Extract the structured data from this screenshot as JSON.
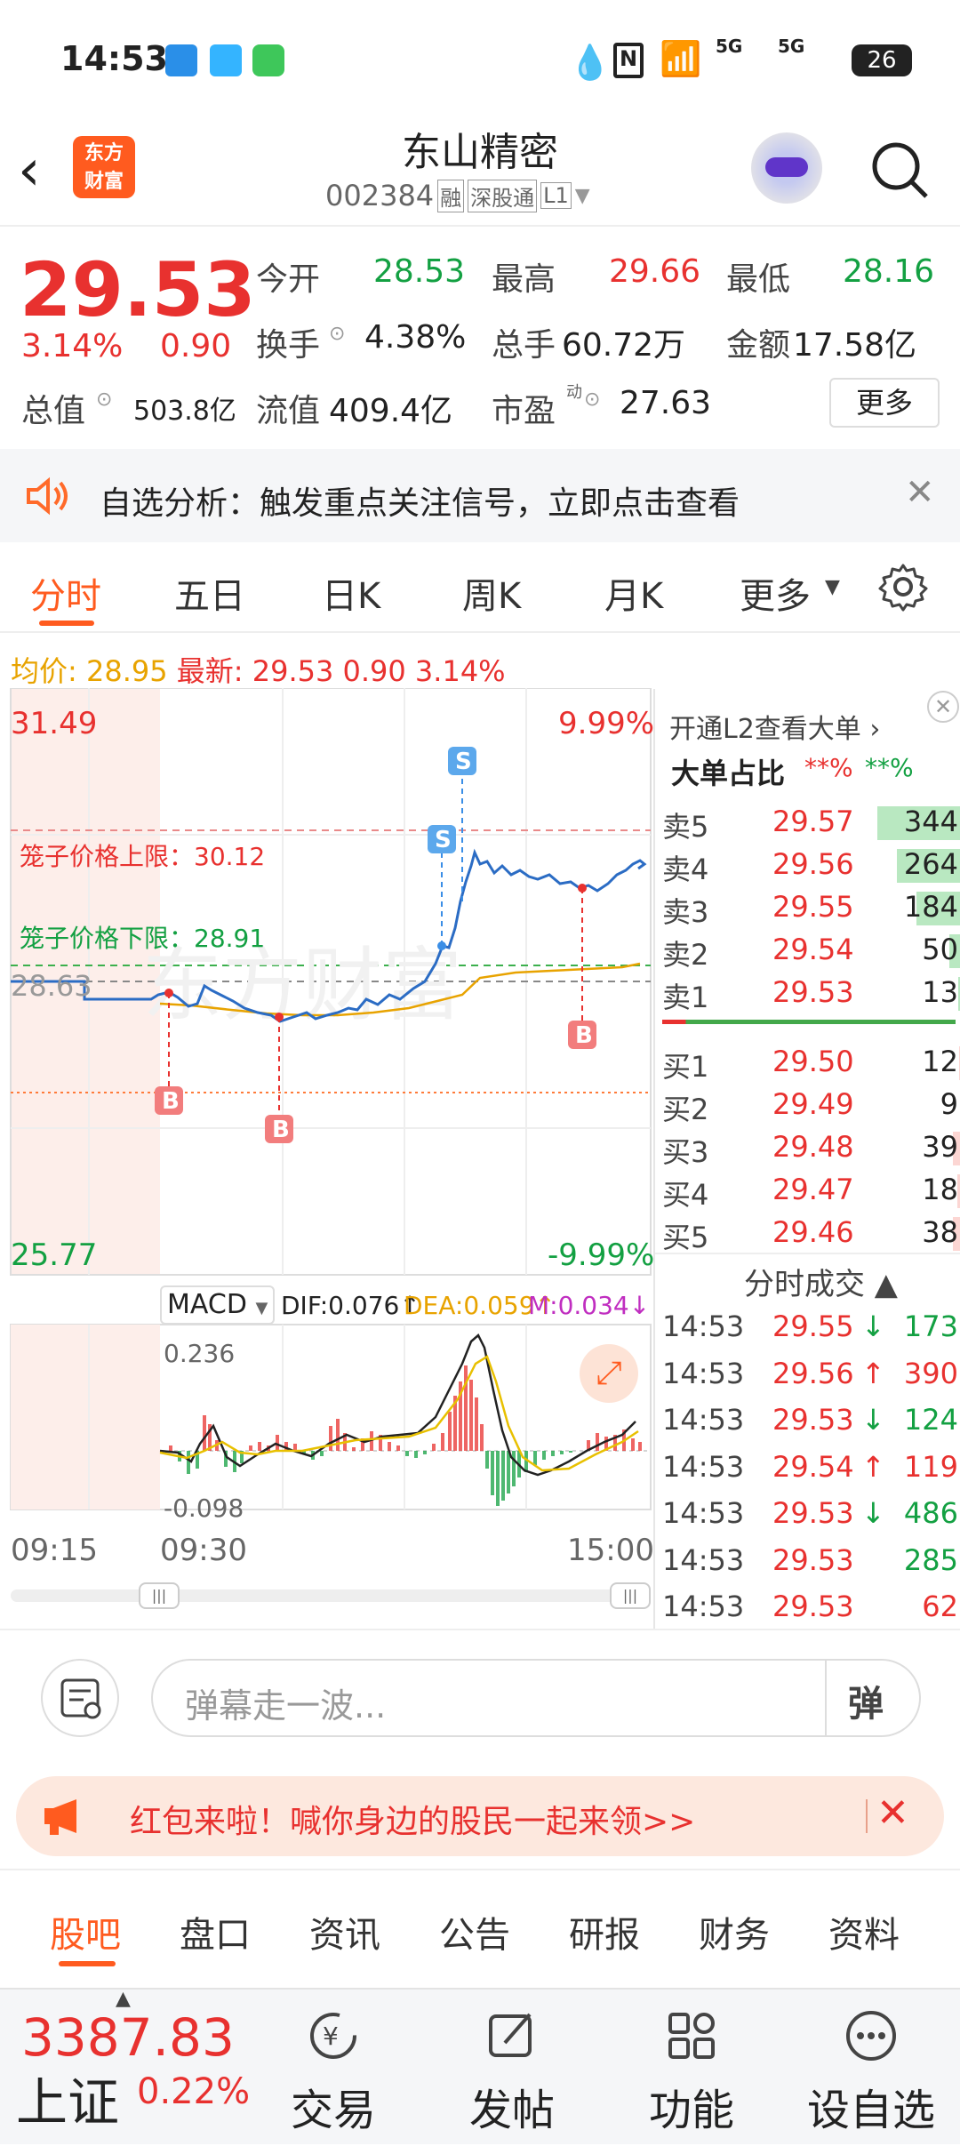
{
  "status": {
    "time": "14:53",
    "battery": "26",
    "net1": "5G",
    "net2": "5G"
  },
  "header": {
    "logo_line1": "东方",
    "logo_line2": "财富",
    "stock_name": "东山精密",
    "stock_code": "002384",
    "tag_margin": "融",
    "tag_connect": "深股通",
    "tag_level": "L1"
  },
  "quote": {
    "price": "29.53",
    "change_pct": "3.14%",
    "change_amt": "0.90",
    "open_label": "今开",
    "open": "28.53",
    "high_label": "最高",
    "high": "29.66",
    "low_label": "最低",
    "low": "28.16",
    "turnover_label": "换手",
    "turnover": "4.38%",
    "volume_label": "总手",
    "volume": "60.72万",
    "amount_label": "金额",
    "amount": "17.58亿",
    "mktcap_label": "总值",
    "mktcap": "503.8亿",
    "float_label": "流值",
    "float_cap": "409.4亿",
    "pe_label": "市盈",
    "pe_sup": "动",
    "pe": "27.63",
    "more_label": "更多"
  },
  "banner": {
    "text": "自选分析：触发重点关注信号，立即点击查看"
  },
  "tabs": [
    "分时",
    "五日",
    "日K",
    "周K",
    "月K",
    "更多"
  ],
  "info_line": {
    "avg_label": "均价:",
    "avg": "28.95",
    "last_label": "最新:",
    "last": "29.53",
    "chg": "0.90",
    "pct": "3.14%"
  },
  "chart": {
    "y_top": "31.49",
    "y_bottom": "25.77",
    "y_mid": "28.63",
    "pct_top": "9.99%",
    "pct_bottom": "-9.99%",
    "upper_limit": "笼子价格上限：30.12",
    "lower_limit": "笼子价格下限：28.91",
    "macd_label": "MACD",
    "dif": "DIF:0.076↑",
    "dea": "DEA:0.059↑",
    "m": "M:0.034↓",
    "macd_top": "0.236",
    "macd_bottom": "-0.098",
    "t_start": "09:15",
    "t_open": "09:30",
    "t_end": "15:00",
    "marker_buy": "B",
    "marker_sell": "S",
    "colors": {
      "price_line": "#2b6cc4",
      "avg_line": "#e8a300",
      "up": "#e8312f",
      "down": "#13a042"
    }
  },
  "orderbook": {
    "l2_label": "开通L2查看大单",
    "big_label": "大单占比",
    "big_red": "**%",
    "big_green": "**%",
    "asks": [
      {
        "label": "卖5",
        "price": "29.57",
        "vol": "344",
        "fill": 0.95
      },
      {
        "label": "卖4",
        "price": "29.56",
        "vol": "264",
        "fill": 0.73
      },
      {
        "label": "卖3",
        "price": "29.55",
        "vol": "184",
        "fill": 0.51
      },
      {
        "label": "卖2",
        "price": "29.54",
        "vol": "50",
        "fill": 0.14
      },
      {
        "label": "卖1",
        "price": "29.53",
        "vol": "13",
        "fill": 0.04
      }
    ],
    "bids": [
      {
        "label": "买1",
        "price": "29.50",
        "vol": "12",
        "fill": 0.03
      },
      {
        "label": "买2",
        "price": "29.49",
        "vol": "9",
        "fill": 0.02
      },
      {
        "label": "买3",
        "price": "29.48",
        "vol": "39",
        "fill": 0.1
      },
      {
        "label": "买4",
        "price": "29.47",
        "vol": "18",
        "fill": 0.05
      },
      {
        "label": "买5",
        "price": "29.46",
        "vol": "38",
        "fill": 0.1
      }
    ],
    "trades_label": "分时成交",
    "trades": [
      {
        "time": "14:53",
        "price": "29.55",
        "dir": "↓",
        "vol": "173",
        "color": "green"
      },
      {
        "time": "14:53",
        "price": "29.56",
        "dir": "↑",
        "vol": "390",
        "color": "red"
      },
      {
        "time": "14:53",
        "price": "29.53",
        "dir": "↓",
        "vol": "124",
        "color": "green"
      },
      {
        "time": "14:53",
        "price": "29.54",
        "dir": "↑",
        "vol": "119",
        "color": "red"
      },
      {
        "time": "14:53",
        "price": "29.53",
        "dir": "↓",
        "vol": "486",
        "color": "green"
      },
      {
        "time": "14:53",
        "price": "29.53",
        "dir": "",
        "vol": "285",
        "color": "green"
      },
      {
        "time": "14:53",
        "price": "29.53",
        "dir": "",
        "vol": "62",
        "color": "red"
      }
    ]
  },
  "danmu": {
    "placeholder": "弹幕走一波...",
    "btn": "弹"
  },
  "redpack": {
    "text": "红包来啦！喊你身边的股民一起来领>>"
  },
  "bottom_tabs": [
    "股吧",
    "盘口",
    "资讯",
    "公告",
    "研报",
    "财务",
    "资料"
  ],
  "bottom_nav": {
    "index_value": "3387.83",
    "index_name": "上证",
    "index_pct": "0.22%",
    "items": [
      "交易",
      "发帖",
      "功能",
      "设自选"
    ]
  }
}
